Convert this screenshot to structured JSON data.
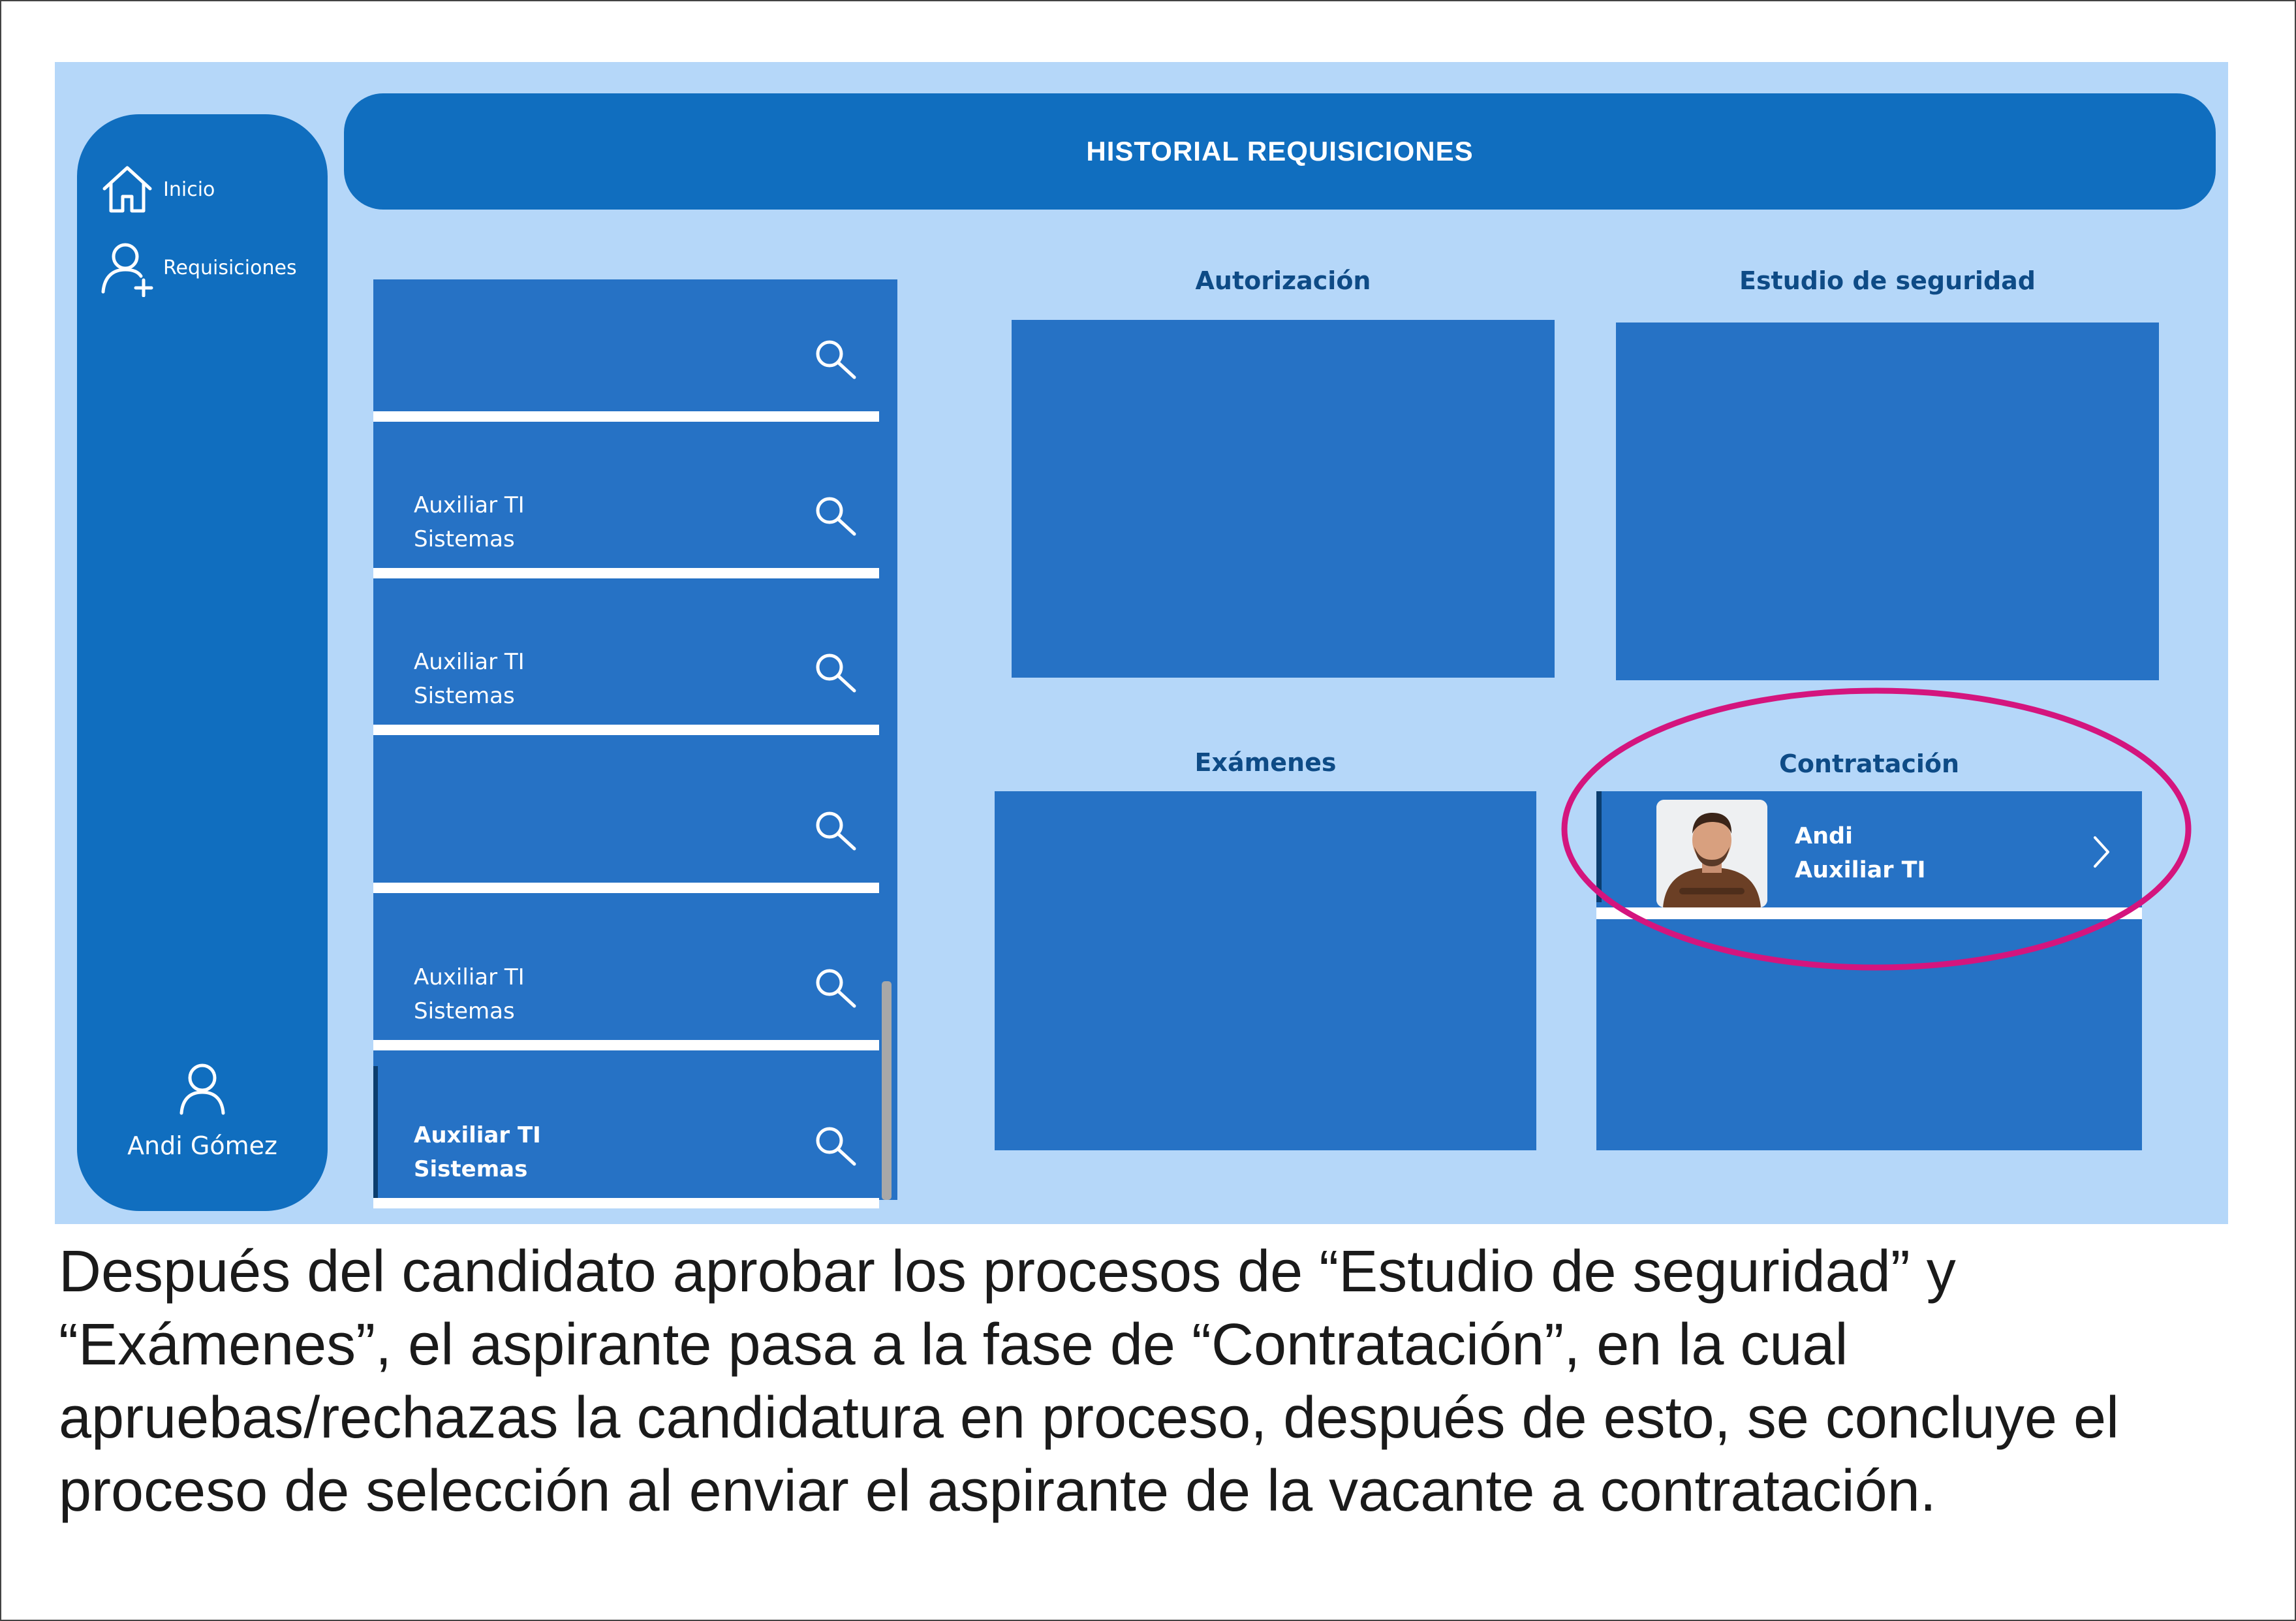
{
  "sidebar": {
    "items": [
      {
        "label": "Inicio",
        "icon": "home-icon"
      },
      {
        "label": "Requisiciones",
        "icon": "add-user-icon"
      }
    ],
    "user": {
      "name": "Andi Gómez",
      "icon": "user-icon"
    }
  },
  "header": {
    "title": "HISTORIAL REQUISICIONES"
  },
  "requisitions": [
    {
      "line1": "",
      "line2": ""
    },
    {
      "line1": "Auxiliar TI",
      "line2": "Sistemas"
    },
    {
      "line1": "Auxiliar TI",
      "line2": "Sistemas"
    },
    {
      "line1": "",
      "line2": ""
    },
    {
      "line1": "Auxiliar TI",
      "line2": "Sistemas"
    },
    {
      "line1": "Auxiliar TI",
      "line2": "Sistemas"
    }
  ],
  "sections": {
    "autorizacion": "Autorización",
    "estudio": "Estudio de seguridad",
    "examenes": "Exámenes",
    "contratacion": "Contratación"
  },
  "contratacion_card": {
    "name": "Andi",
    "role": "Auxiliar TI"
  },
  "caption": "Después del candidato aprobar los procesos de “Estudio de seguridad” y “Exámenes”, el aspirante pasa a la fase de “Contratación”, en la cual apruebas/rechazas la candidatura en proceso, después de esto, se concluye el proceso de selección al enviar el aspirante de la vacante a contratación.",
  "colors": {
    "app_background": "#b5d7f9",
    "primary": "#106ebf",
    "panel": "#2672c5",
    "highlight": "#d4157e"
  }
}
